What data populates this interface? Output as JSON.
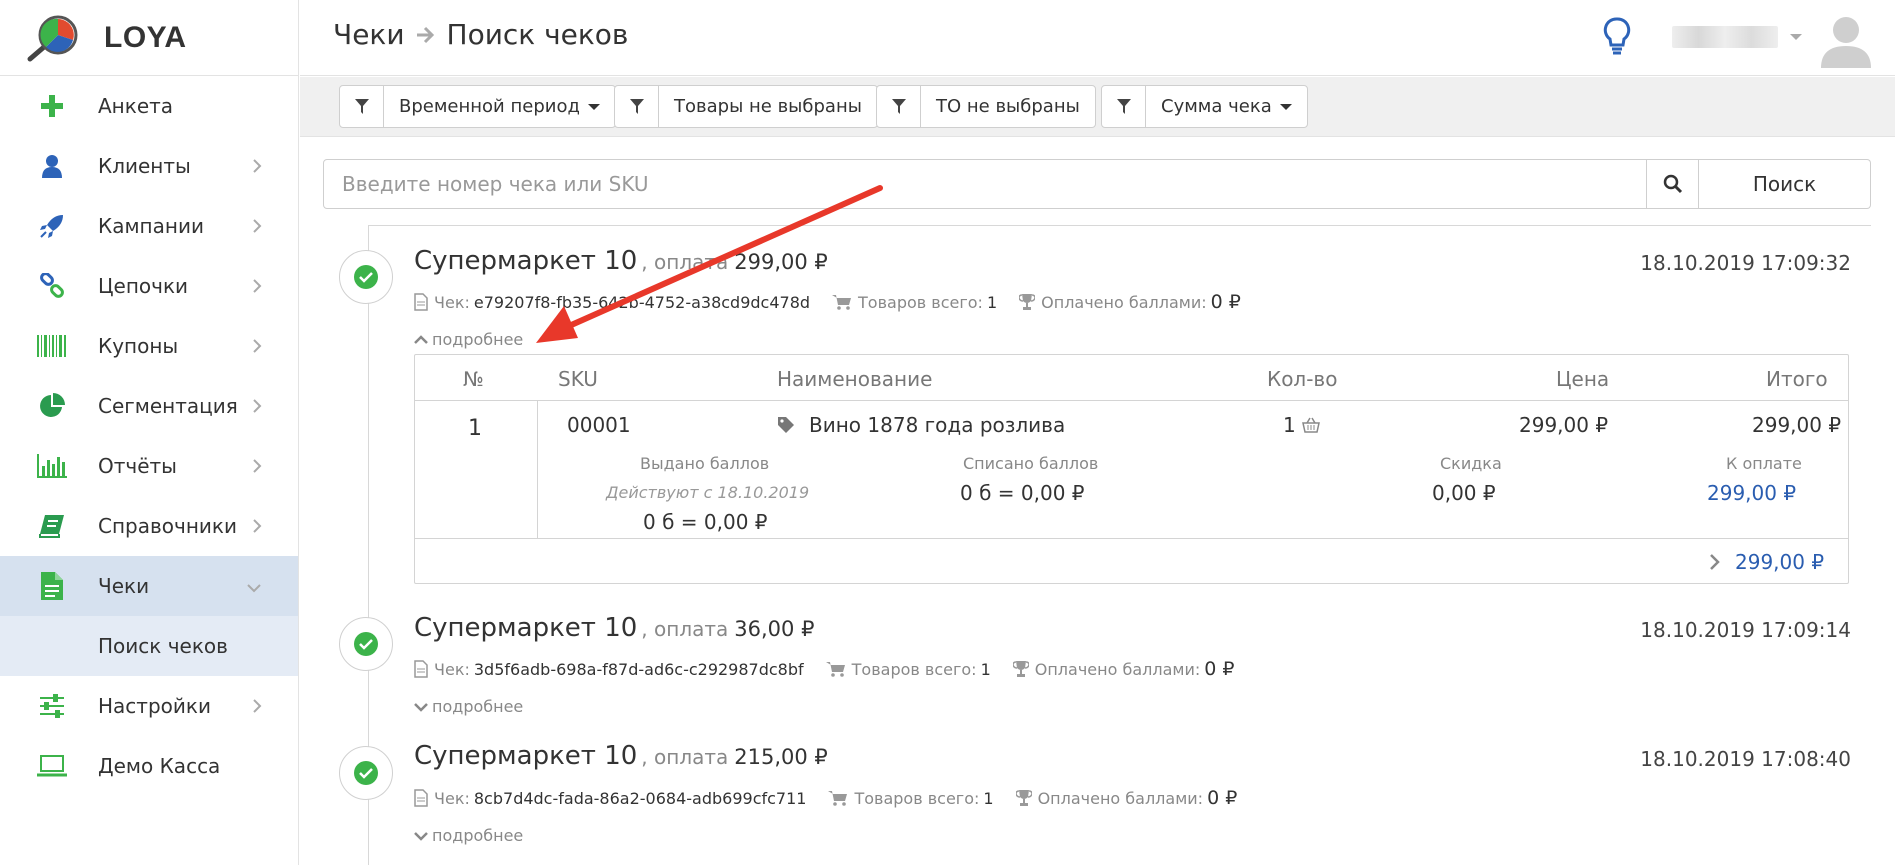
{
  "app": {
    "name": "LOYA"
  },
  "sidebar": {
    "items": [
      {
        "label": "Анкета",
        "icon": "plus-icon",
        "has_chevron": false
      },
      {
        "label": "Клиенты",
        "icon": "user-icon",
        "has_chevron": true
      },
      {
        "label": "Кампании",
        "icon": "rocket-icon",
        "has_chevron": true
      },
      {
        "label": "Цепочки",
        "icon": "link-icon",
        "has_chevron": true
      },
      {
        "label": "Купоны",
        "icon": "barcode-icon",
        "has_chevron": true
      },
      {
        "label": "Сегментация",
        "icon": "pie-chart-icon",
        "has_chevron": true
      },
      {
        "label": "Отчёты",
        "icon": "bar-chart-icon",
        "has_chevron": true
      },
      {
        "label": "Справочники",
        "icon": "book-icon",
        "has_chevron": true
      },
      {
        "label": "Чеки",
        "icon": "document-icon",
        "has_chevron": true,
        "active": true
      },
      {
        "label": "Настройки",
        "icon": "sliders-icon",
        "has_chevron": true
      },
      {
        "label": "Демо Касса",
        "icon": "laptop-icon",
        "has_chevron": false
      }
    ],
    "subitem": "Поиск чеков"
  },
  "header": {
    "breadcrumb_parent": "Чеки",
    "breadcrumb_current": "Поиск чеков"
  },
  "filters": [
    {
      "label": "Временной период",
      "dropdown": true
    },
    {
      "label": "Товары не выбраны",
      "dropdown": false
    },
    {
      "label": "ТО не выбраны",
      "dropdown": false
    },
    {
      "label": "Сумма чека",
      "dropdown": true
    }
  ],
  "search": {
    "placeholder": "Введите номер чека или SKU",
    "button_label": "Поиск"
  },
  "labels": {
    "pay": ", оплата",
    "receipt": "Чек:",
    "items_total": "Товаров всего:",
    "paid_points": "Оплачено баллами:",
    "more": "подробнее"
  },
  "receipts": [
    {
      "store": "Супермаркет 10",
      "amount": "299,00 ₽",
      "date": "18.10.2019 17:09:32",
      "id": "e79207f8-fb35-642b-4752-a38cd9dc478d",
      "items_count": "1",
      "points_paid": "0 ₽",
      "expanded": true
    },
    {
      "store": "Супермаркет 10",
      "amount": "36,00 ₽",
      "date": "18.10.2019 17:09:14",
      "id": "3d5f6adb-698a-f87d-ad6c-c292987dc8bf",
      "items_count": "1",
      "points_paid": "0 ₽",
      "expanded": false
    },
    {
      "store": "Супермаркет 10",
      "amount": "215,00 ₽",
      "date": "18.10.2019 17:08:40",
      "id": "8cb7d4dc-fada-86a2-0684-adb699cfc711",
      "items_count": "1",
      "points_paid": "0 ₽",
      "expanded": false
    }
  ],
  "detail": {
    "headers": {
      "num": "№",
      "sku": "SKU",
      "name": "Наименование",
      "qty": "Кол-во",
      "price": "Цена",
      "total": "Итого"
    },
    "row": {
      "num": "1",
      "sku": "00001",
      "name": "Вино 1878 года розлива",
      "qty": "1",
      "price": "299,00 ₽",
      "total": "299,00 ₽"
    },
    "extra": {
      "issued_label": "Выдано баллов",
      "issued_note": "Действуют с 18.10.2019",
      "issued_value": "0 б = 0,00 ₽",
      "written_label": "Списано баллов",
      "written_value": "0 б = 0,00 ₽",
      "discount_label": "Скидка",
      "discount_value": "0,00 ₽",
      "topay_label": "К оплате",
      "topay_value": "299,00 ₽"
    },
    "footer_total": "299,00 ₽"
  },
  "colors": {
    "accent_green": "#3cb34a",
    "accent_blue": "#2a5db0",
    "arrow_red": "#e8382a",
    "active_bg": "#d6e1ef"
  }
}
